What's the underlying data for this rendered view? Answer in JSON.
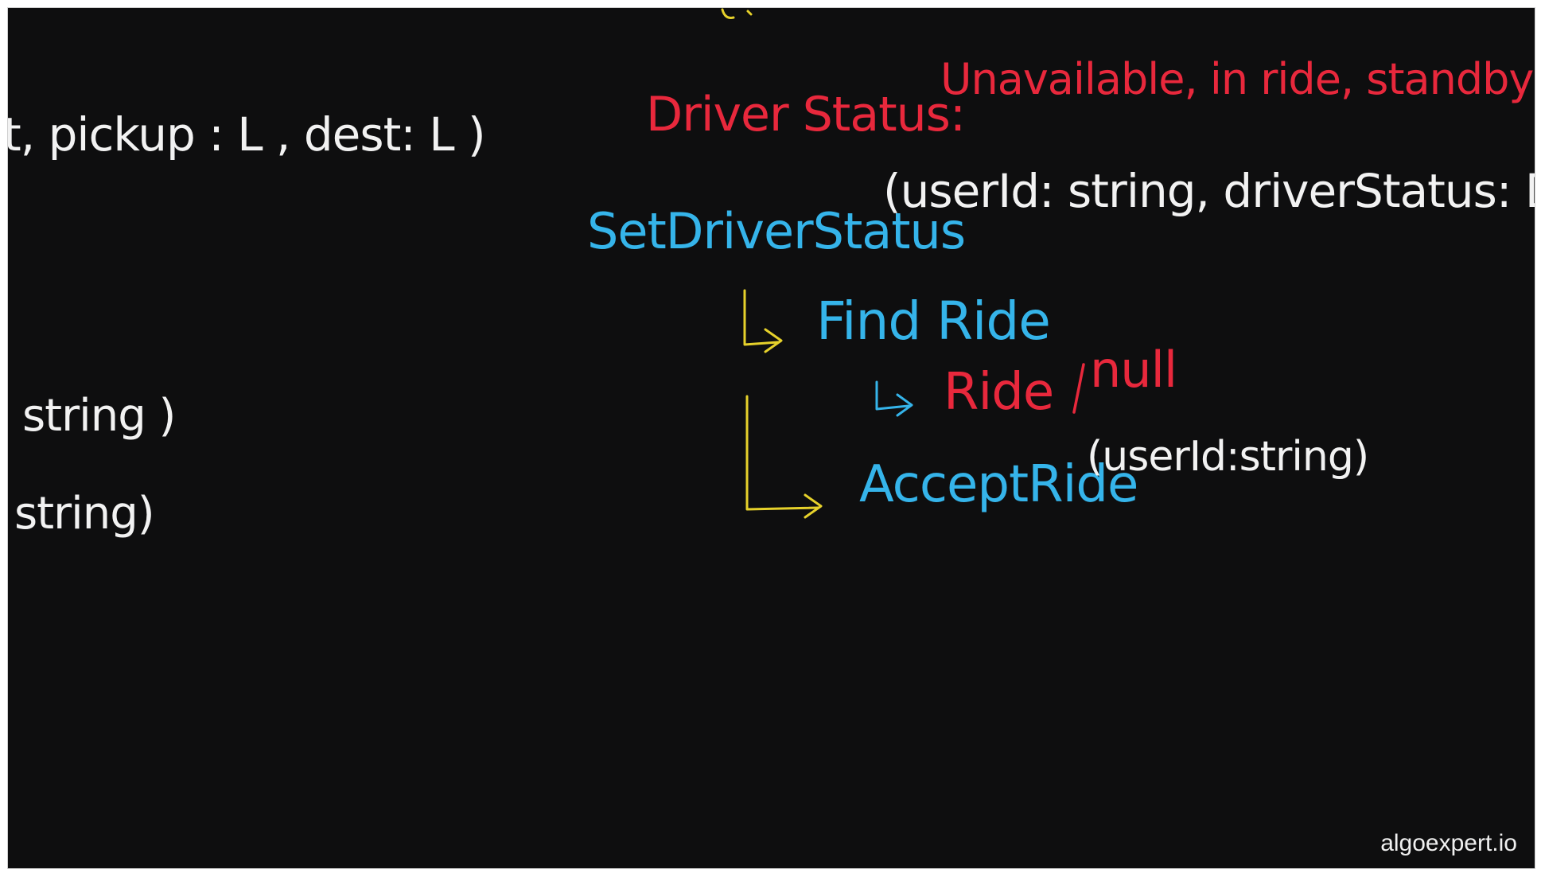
{
  "left": {
    "line1": "t, pickup : L , dest: L )",
    "line2": "string )",
    "line3": "string)"
  },
  "right": {
    "status_label": "Driver Status:",
    "status_values": "Unavailable, in ride, standby",
    "set_fn": "SetDriverStatus",
    "set_args": "(userId: string, driverStatus: DS)",
    "find_ride": "Find Ride",
    "ride": "Ride",
    "null": "null",
    "accept_fn": "AcceptRide",
    "accept_args": "(userId:string)"
  },
  "watermark": "algoexpert.io",
  "colors": {
    "background": "#0e0e0f",
    "white_ink": "#f2f2f2",
    "red_ink": "#e8283c",
    "blue_ink": "#35b4ea",
    "yellow_ink": "#e6d12b"
  }
}
